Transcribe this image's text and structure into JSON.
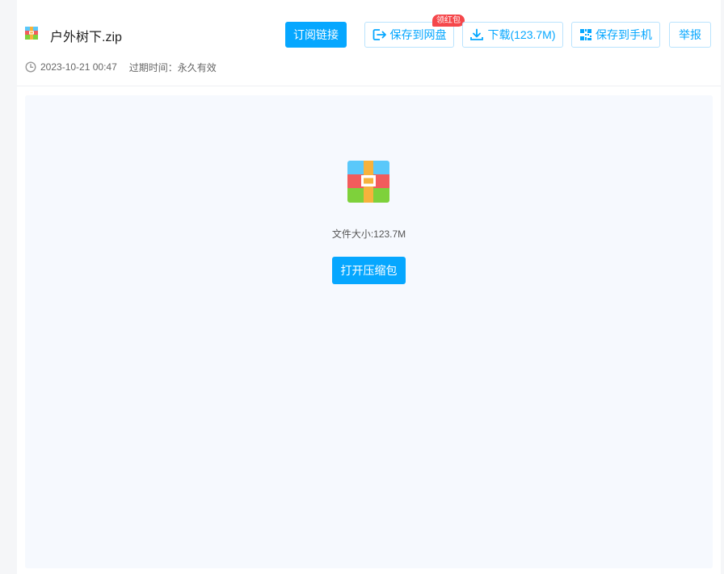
{
  "file": {
    "name": "户外树下.zip",
    "date": "2023-10-21 00:47",
    "expire_label": "过期时间：",
    "expire_value": "永久有效",
    "size_text": "文件大小:123.7M"
  },
  "toolbar": {
    "subscribe_label": "订阅链接",
    "save_cloud_label": "保存到网盘",
    "badge_label": "领红包",
    "download_label": "下载(123.7M)",
    "save_phone_label": "保存到手机",
    "report_label": "举报"
  },
  "preview": {
    "open_label": "打开压缩包"
  },
  "icons": {
    "archive": "zip-archive-icon",
    "clock": "clock-icon",
    "save": "save-to-cloud-icon",
    "download": "download-icon",
    "qr": "qr-code-icon"
  },
  "colors": {
    "accent": "#06a7ff",
    "badge": "#f5474b",
    "preview_bg": "#f6f9fe"
  }
}
